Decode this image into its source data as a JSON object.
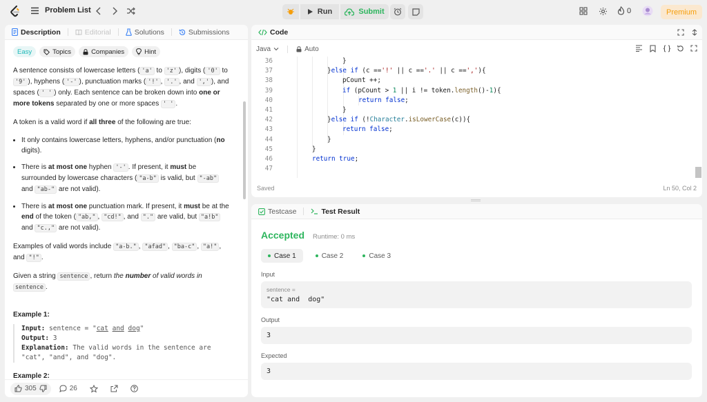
{
  "topbar": {
    "problem_list": "Problem List",
    "run": "Run",
    "submit": "Submit",
    "fire_count": "0",
    "premium": "Premium"
  },
  "left": {
    "tabs": [
      "Description",
      "Editorial",
      "Solutions",
      "Submissions"
    ],
    "chips": [
      "Easy",
      "Topics",
      "Companies",
      "Hint"
    ],
    "likes": "305",
    "comments": "26"
  },
  "code": {
    "title": "Code",
    "language": "Java",
    "mode": "Auto",
    "status_left": "Saved",
    "status_right": "Ln 50, Col 2",
    "line_numbers": [
      "36",
      "37",
      "38",
      "39",
      "40",
      "41",
      "42",
      "43",
      "44",
      "45",
      "46",
      "47"
    ]
  },
  "result": {
    "tabs": [
      "Testcase",
      "Test Result"
    ],
    "verdict": "Accepted",
    "runtime": "Runtime: 0 ms",
    "cases": [
      "Case 1",
      "Case 2",
      "Case 3"
    ],
    "input_label": "Input",
    "input_var": "sentence =",
    "input_value": "\"cat and  dog\"",
    "output_label": "Output",
    "output_value": "3",
    "expected_label": "Expected",
    "expected_value": "3"
  },
  "colors": {
    "accent_green": "#2db55d",
    "easy": "#1cb8b8",
    "premium": "#f59e0b"
  }
}
